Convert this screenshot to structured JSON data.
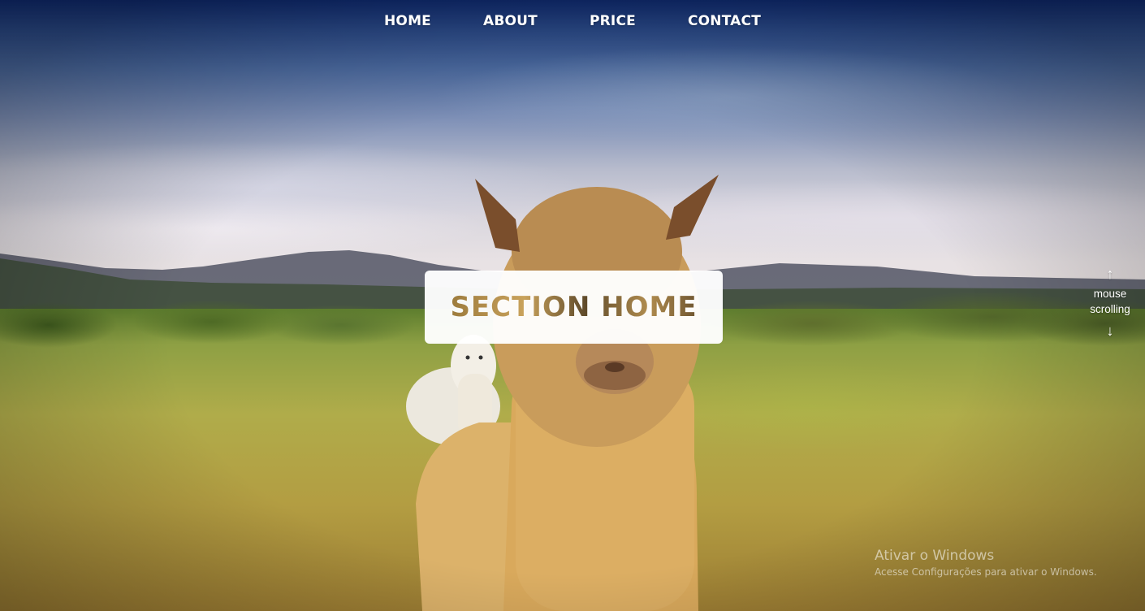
{
  "nav": {
    "items": [
      {
        "label": "HOME"
      },
      {
        "label": "ABOUT"
      },
      {
        "label": "PRICE"
      },
      {
        "label": "CONTACT"
      }
    ]
  },
  "hero": {
    "title": "SECTION HOME"
  },
  "scroll_hint": {
    "up_icon": "arrow-up-icon",
    "label_line1": "mouse",
    "label_line2": "scrolling",
    "down_icon": "arrow-down-icon"
  },
  "watermark": {
    "title": "Ativar o Windows",
    "subtitle": "Acesse Configurações para ativar o Windows."
  },
  "colors": {
    "nav_text": "#ffffff",
    "card_bg": "#ffffff"
  }
}
